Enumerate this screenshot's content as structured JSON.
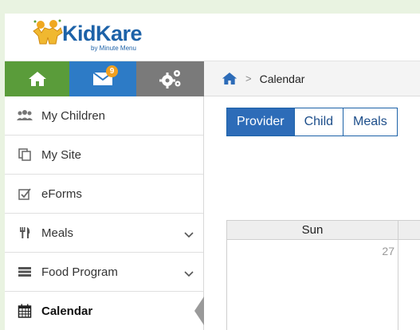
{
  "header": {
    "logo_name": "KidKare",
    "logo_tagline": "by Minute Menu"
  },
  "iconbar": {
    "mail_badge": "9",
    "colors": {
      "home": "#5a9c3a",
      "mail": "#2d7bc6",
      "settings": "#7a7a7a",
      "badge": "#f0a020"
    }
  },
  "breadcrumb": {
    "separator": ">",
    "current": "Calendar"
  },
  "sidebar": {
    "items": [
      {
        "label": "My Children",
        "icon": "children-icon",
        "expandable": false
      },
      {
        "label": "My Site",
        "icon": "copy-icon",
        "expandable": false
      },
      {
        "label": "eForms",
        "icon": "checkbox-edit-icon",
        "expandable": false
      },
      {
        "label": "Meals",
        "icon": "fork-knife-icon",
        "expandable": true
      },
      {
        "label": "Food Program",
        "icon": "server-icon",
        "expandable": true
      },
      {
        "label": "Calendar",
        "icon": "calendar-icon",
        "expandable": false,
        "active": true
      }
    ]
  },
  "tabs": [
    {
      "label": "Provider",
      "active": true
    },
    {
      "label": "Child",
      "active": false
    },
    {
      "label": "Meals",
      "active": false
    }
  ],
  "calendar": {
    "day_headers": [
      "Sun"
    ],
    "day_numbers": [
      "27"
    ]
  }
}
